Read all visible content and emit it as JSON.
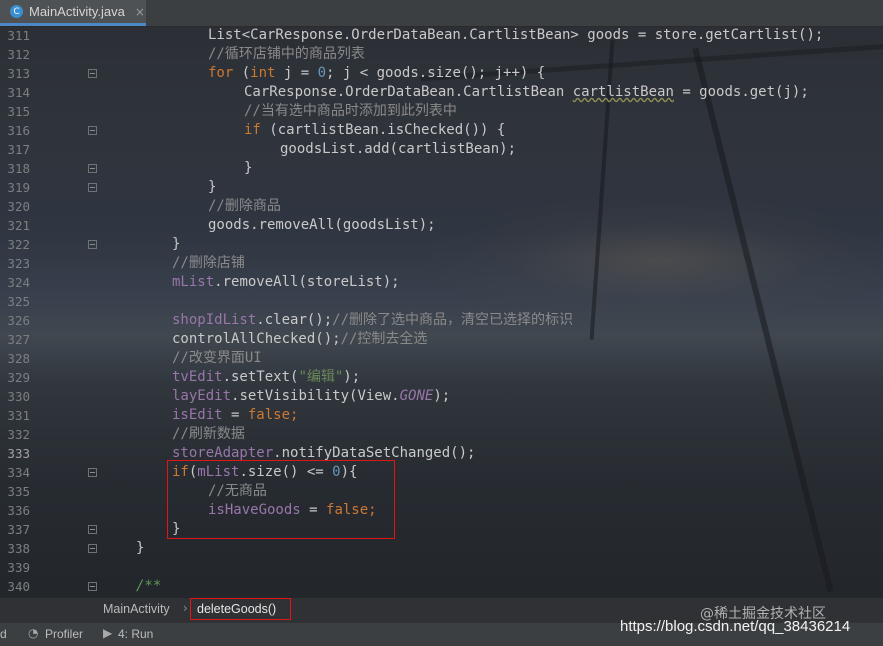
{
  "tab": {
    "filename": "MainActivity.java",
    "icon": "C",
    "close": "×"
  },
  "line_numbers": [
    "311",
    "312",
    "313",
    "314",
    "315",
    "316",
    "317",
    "318",
    "319",
    "320",
    "321",
    "322",
    "323",
    "324",
    "325",
    "326",
    "327",
    "328",
    "329",
    "330",
    "331",
    "332",
    "333",
    "334",
    "335",
    "336",
    "337",
    "338",
    "339",
    "340"
  ],
  "current_line": "333",
  "code": {
    "l311": [
      "List<CarResponse.OrderDataBean.CartlistBean> goods = store.getCartlist();"
    ],
    "l312": "//循环店铺中的商品列表",
    "l313": [
      "for",
      " (",
      "int",
      " j = ",
      "0",
      "; j < goods.size(); j++) {"
    ],
    "l314": [
      "CarResponse.OrderDataBean.CartlistBean ",
      "cartlistBean",
      " = goods.get(j);"
    ],
    "l315": "//当有选中商品时添加到此列表中",
    "l316": [
      "if",
      " (cartlistBean.isChecked()) {"
    ],
    "l317": "goodsList.add(cartlistBean);",
    "l318": "}",
    "l319": "}",
    "l320": "//删除商品",
    "l321": "goods.removeAll(goodsList);",
    "l322": "}",
    "l323": "//删除店铺",
    "l324": [
      "mList",
      ".removeAll(storeList);"
    ],
    "l326": [
      "shopIdList",
      ".clear();",
      "//删除了选中商品，清空已选择的标识"
    ],
    "l327": [
      "controlAllChecked();",
      "//控制去全选"
    ],
    "l328": "//改变界面UI",
    "l329": [
      "tvEdit",
      ".setText(",
      "\"编辑\"",
      ");"
    ],
    "l330": [
      "layEdit",
      ".setVisibility(View.",
      "GONE",
      ");"
    ],
    "l331": [
      "isEdit",
      " = ",
      "false",
      ";"
    ],
    "l332": "//刷新数据",
    "l333": [
      "storeAdapter",
      ".notifyDataSetChanged();"
    ],
    "l334": [
      "if",
      "(",
      "mList",
      ".size() <= ",
      "0",
      "){"
    ],
    "l335": "//无商品",
    "l336": [
      "isHaveGoods",
      " = ",
      "false",
      ";"
    ],
    "l337": "}",
    "l338": "}",
    "l340": "/**"
  },
  "breadcrumb": {
    "class": "MainActivity",
    "separator": "›",
    "method": "deleteGoods()"
  },
  "toolbar": {
    "left_fragment": "d",
    "profiler": "Profiler",
    "run": "4: Run"
  },
  "watermark": {
    "juejin": "@稀土掘金技术社区",
    "csdn": "https://blog.csdn.net/qq_38436214"
  },
  "colors": {
    "keyword": "#cc7832",
    "number": "#6897bb",
    "string": "#6a8759",
    "field": "#9876aa",
    "comment": "#8a8a8a",
    "highlight_box": "#e01515"
  }
}
